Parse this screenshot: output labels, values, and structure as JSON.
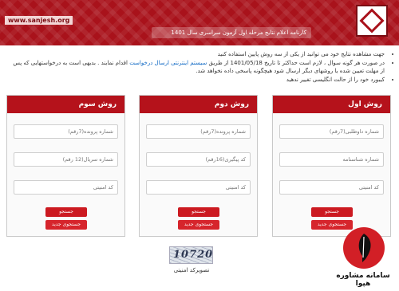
{
  "header": {
    "site": "www.sanjesh.org",
    "title": "کارنامه اعلام نتایج مرحله اول آزمون سراسری سال 1401"
  },
  "instructions": {
    "items": [
      "جهت مشاهده نتایج خود می توانید از یکی از سه روش پایین استفاده کنید",
      "در صورت هر گونه سوال ، لازم است حداکثر تا تاریخ 1401/05/18 از طریق",
      "سیستم اینترنتی ارسال درخواست",
      "اقدام نمایند . بدیهی است به درخواستهایی که پس از مهلت تعیین شده یا روشهای دیگر ارسال شود هیچگونه پاسخی داده نخواهد شد.",
      "کیبورد خود را از حالت انگلیسی تغییر ندهید"
    ]
  },
  "columns": [
    {
      "title": "روش اول",
      "fields": [
        "شماره داوطلبی(7رقم)",
        "شماره شناسنامه",
        "کد امنیتی"
      ],
      "search_label": "جستجو",
      "new_search_label": "جستجوی جدید"
    },
    {
      "title": "روش دوم",
      "fields": [
        "شماره پرونده(7رقم)",
        "کد پیگیری(16رقم)",
        "کد امنیتی"
      ],
      "search_label": "جستجو",
      "new_search_label": "جستجوی جدید"
    },
    {
      "title": "روش سوم",
      "fields": [
        "شماره پرونده(7رقم)",
        "شماره سریال(12 رقم)",
        "کد امنیتی"
      ],
      "search_label": "جستجو",
      "new_search_label": "جستجوی جدید"
    }
  ],
  "captcha": {
    "code": "10720",
    "label": "تصویرکد امنیتی"
  },
  "watermark": {
    "text": "سامانه مشاوره هپوا"
  },
  "colors": {
    "brand": "#a9121b",
    "button": "#cc1a21"
  }
}
